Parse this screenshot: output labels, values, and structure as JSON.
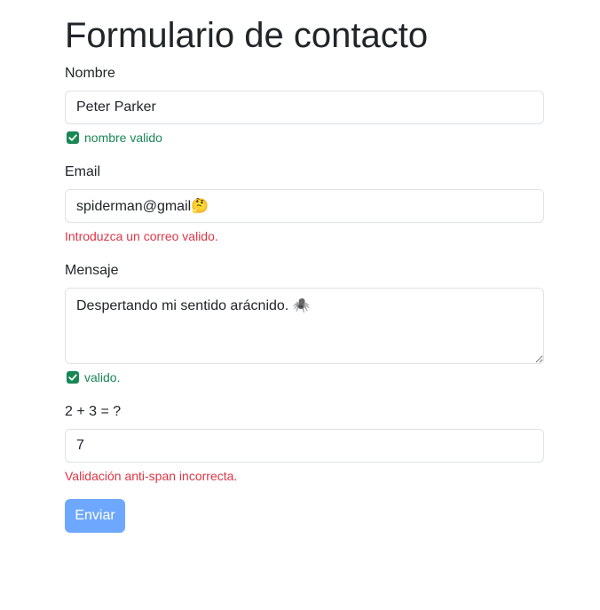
{
  "page": {
    "title": "Formulario de contacto"
  },
  "form": {
    "nombre": {
      "label": "Nombre",
      "value": "Peter Parker",
      "feedback": "nombre valido",
      "status": "valid"
    },
    "email": {
      "label": "Email",
      "value": "spiderman@gmail🤔",
      "feedback": "Introduzca un correo valido.",
      "status": "invalid"
    },
    "mensaje": {
      "label": "Mensaje",
      "value": "Despertando mi sentido arácnido. 🕷️",
      "feedback": "valido.",
      "status": "valid"
    },
    "captcha": {
      "label": "2 + 3 = ?",
      "value": "7",
      "feedback": "Validación anti-span incorrecta.",
      "status": "invalid"
    },
    "submit_label": "Enviar"
  },
  "colors": {
    "valid": "#198754",
    "invalid": "#dc3545",
    "button": "#6ea8fe"
  },
  "icons": {
    "valid_feedback": "check-square-icon"
  }
}
